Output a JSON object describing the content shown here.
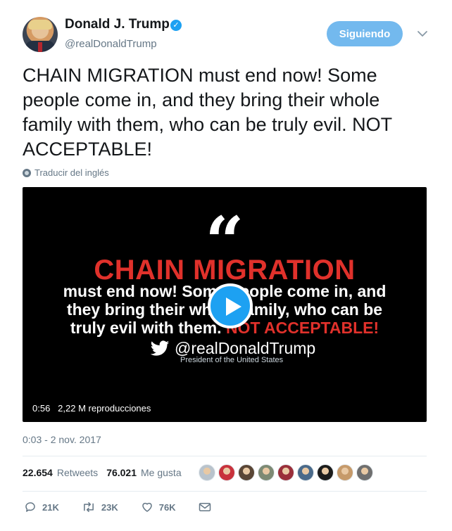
{
  "author": {
    "name": "Donald J. Trump",
    "handle": "@realDonaldTrump",
    "verified_mark": "✓"
  },
  "follow_button": {
    "label": "Siguiendo"
  },
  "tweet": {
    "text": "CHAIN MIGRATION must end now! Some people come in, and they bring their whole family with them, who can be truly evil. NOT ACCEPTABLE!",
    "translate_label": "Traducir del inglés",
    "timestamp": "0:03 - 2 nov. 2017"
  },
  "video": {
    "quote_mark": "“",
    "title": "CHAIN MIGRATION",
    "line1": "must end now! Some people come in, and",
    "line2": "they bring their whole family, who can be",
    "line3_white": "truly evil with them. ",
    "line3_red": "NOT ACCEPTABLE!",
    "handle": "@realDonaldTrump",
    "subtitle": "President of the United States",
    "duration": "0:56",
    "views": "2,22 M reproducciones"
  },
  "stats": {
    "retweets_count": "22.654",
    "retweets_label": "Retweets",
    "likes_count": "76.021",
    "likes_label": "Me gusta"
  },
  "likers": [
    "#b9c3cc",
    "#c8323c",
    "#5a4636",
    "#7d8a74",
    "#9a2f3a",
    "#4a6a8a",
    "#1c1c1c",
    "#c69a6a",
    "#6f6f6f"
  ],
  "actions": {
    "replies": "21K",
    "retweets": "23K",
    "likes": "76K"
  },
  "colors": {
    "accent": "#1da1f2",
    "follow_button": "#73b9ee",
    "video_red": "#e0312b",
    "secondary_text": "#657786"
  }
}
